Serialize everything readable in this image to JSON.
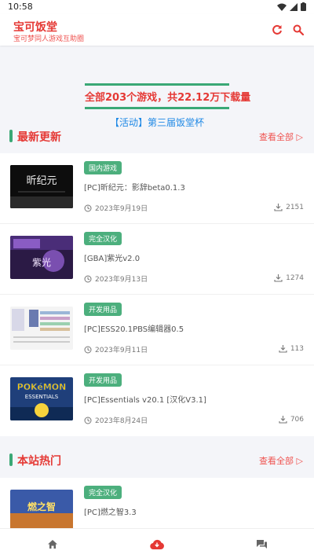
{
  "status": {
    "time": "10:58"
  },
  "header": {
    "title": "宝可饭堂",
    "subtitle": "宝可梦同人游戏互助圈"
  },
  "stats": {
    "text": "全部203个游戏，共22.12万下载量"
  },
  "event": {
    "text": "【活动】第三届饭堂杯"
  },
  "latest": {
    "title": "最新更新",
    "more": "查看全部 ▷",
    "items": [
      {
        "tag": "国内游戏",
        "title": "[PC]昕纪元：影辞beta0.1.3",
        "date": "2023年9月19日",
        "downloads": "2151"
      },
      {
        "tag": "完全汉化",
        "title": "[GBA]紫光v2.0",
        "date": "2023年9月13日",
        "downloads": "1274"
      },
      {
        "tag": "开发用品",
        "title": "[PC]ESS20.1PBS编辑器0.5",
        "date": "2023年9月11日",
        "downloads": "113"
      },
      {
        "tag": "开发用品",
        "title": "[PC]Essentials v20.1 [汉化V3.1]",
        "date": "2023年8月24日",
        "downloads": "706"
      }
    ]
  },
  "hot": {
    "title": "本站热门",
    "more": "查看全部 ▷",
    "items": [
      {
        "tag": "完全汉化",
        "title": "[PC]燃之智3.3"
      }
    ]
  },
  "thumbs": {
    "t1_text": "昕纪元",
    "t2_text": "紫光",
    "t4_logo": "POKéMON",
    "t4_sub": "ESSENTIALS",
    "t5_text": "燃之智"
  },
  "colors": {
    "accent_red": "#e53935",
    "accent_green": "#3aa876",
    "link_blue": "#1e88e5"
  }
}
